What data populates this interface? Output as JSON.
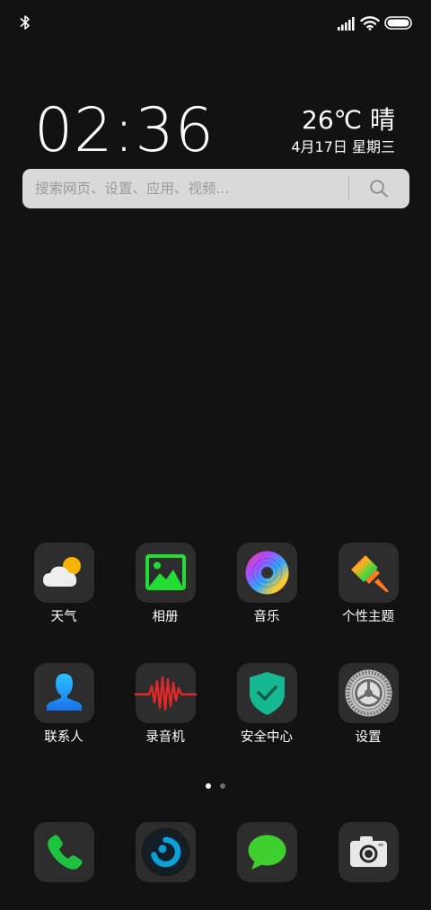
{
  "status_bar": {
    "icons": [
      "bluetooth-icon",
      "cellular-signal-icon",
      "wifi-icon",
      "battery-icon"
    ]
  },
  "clock": {
    "time": "02:36"
  },
  "weather": {
    "temperature_condition": "26℃ 晴",
    "date": "4月17日 星期三"
  },
  "search": {
    "placeholder": "搜索网页、设置、应用、视频..."
  },
  "apps": [
    {
      "label": "天气",
      "icon": "weather-icon"
    },
    {
      "label": "相册",
      "icon": "gallery-icon"
    },
    {
      "label": "音乐",
      "icon": "music-icon"
    },
    {
      "label": "个性主题",
      "icon": "theme-brush-icon"
    },
    {
      "label": "联系人",
      "icon": "contacts-icon"
    },
    {
      "label": "录音机",
      "icon": "recorder-waveform-icon"
    },
    {
      "label": "安全中心",
      "icon": "security-shield-icon"
    },
    {
      "label": "设置",
      "icon": "settings-gear-icon"
    }
  ],
  "page_indicator": {
    "pages": 2,
    "current": 1
  },
  "dock": [
    {
      "icon": "phone-icon"
    },
    {
      "icon": "browser-icon"
    },
    {
      "icon": "messages-icon"
    },
    {
      "icon": "camera-icon"
    }
  ],
  "colors": {
    "background": "#121212",
    "tile": "#2d2d2d",
    "search_bar": "#d9d9d9",
    "search_text": "#9a9a9a",
    "gallery_green": "#22dd33",
    "phone_green": "#1ec23e",
    "messages_green": "#3ecf2e",
    "shield_teal": "#16b891",
    "contacts_blue": "#1da0f2",
    "recorder_red": "#e02828"
  }
}
